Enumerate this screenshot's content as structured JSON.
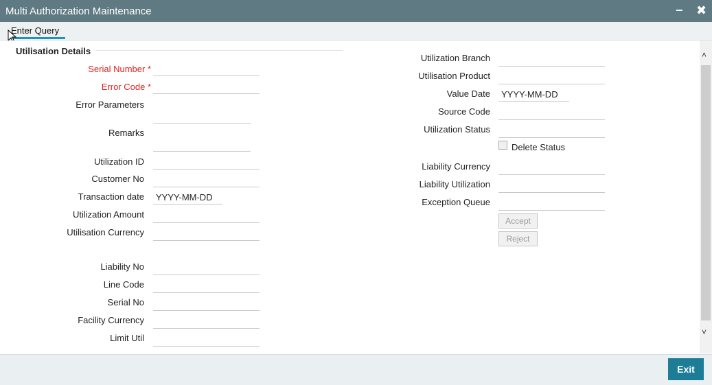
{
  "window": {
    "title": "Multi Authorization Maintenance",
    "minimize": "−",
    "close": "✖"
  },
  "toolbar": {
    "enter_query": "Enter Query"
  },
  "section": {
    "title": "Utilisation Details"
  },
  "left": {
    "serial_number": "Serial Number *",
    "error_code": "Error Code *",
    "error_parameters": "Error Parameters",
    "remarks": "Remarks",
    "utilization_id": "Utilization ID",
    "customer_no": "Customer No",
    "transaction_date": "Transaction date",
    "transaction_date_value": "YYYY-MM-DD",
    "utilization_amount": "Utilization Amount",
    "utilisation_currency": "Utilisation Currency",
    "liability_no": "Liability No",
    "line_code": "Line Code",
    "serial_no": "Serial No",
    "facility_currency": "Facility Currency",
    "limit_util": "Limit Util"
  },
  "right": {
    "utilization_branch": "Utilization Branch",
    "utilisation_product": "Utilisation Product",
    "value_date": "Value Date",
    "value_date_value": "YYYY-MM-DD",
    "source_code": "Source Code",
    "utilization_status": "Utilization Status",
    "delete_status": "Delete Status",
    "liability_currency": "Liability Currency",
    "liability_utilization": "Liability Utilization",
    "exception_queue": "Exception Queue",
    "accept": "Accept",
    "reject": "Reject"
  },
  "footer": {
    "exit": "Exit"
  },
  "scrollbar": {
    "up": "˄",
    "down": "˅"
  },
  "colors": {
    "titlebar": "#5f7a82",
    "required": "#e02020",
    "exit_button": "#1d7d97",
    "tab_underline": "#1f93c7"
  }
}
